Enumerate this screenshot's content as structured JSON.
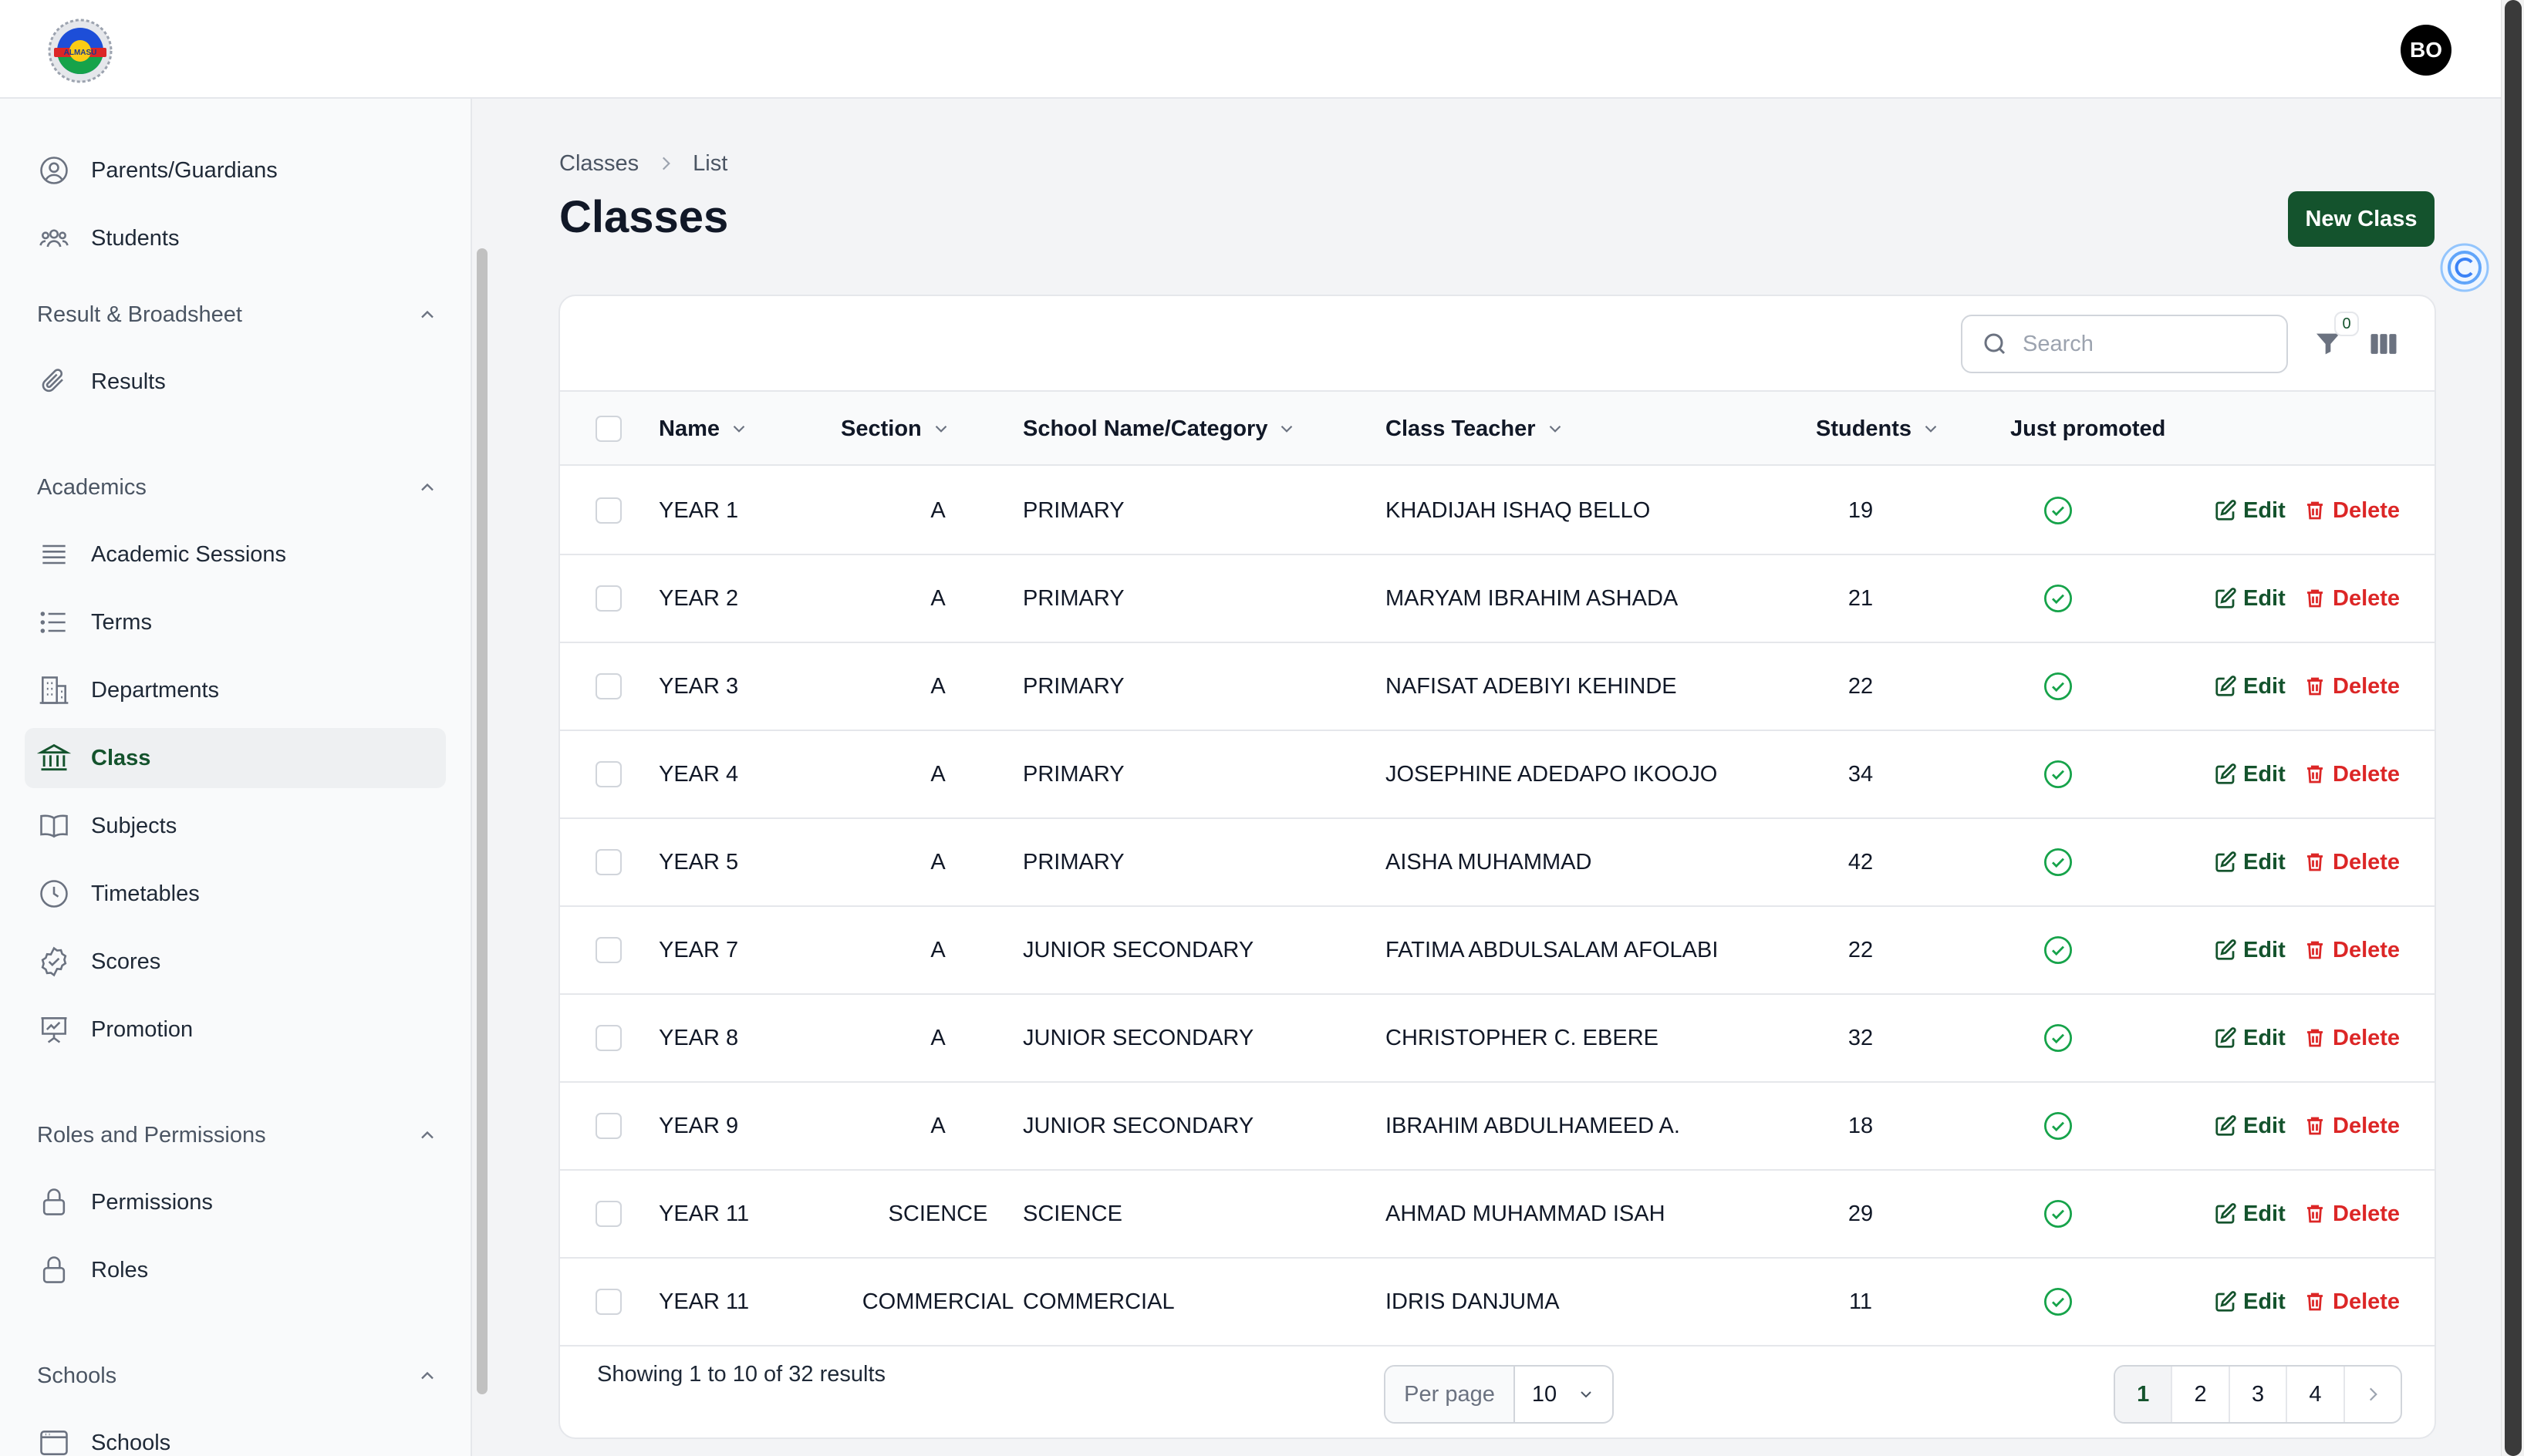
{
  "header": {
    "avatar_initials": "BO",
    "logo_text": "ALMASU"
  },
  "sidebar": {
    "items_top": [
      {
        "label": "Parents/Guardians",
        "icon": "user-circle-icon"
      },
      {
        "label": "Students",
        "icon": "user-group-icon"
      }
    ],
    "groups": [
      {
        "label": "Result & Broadsheet",
        "items": [
          {
            "label": "Results",
            "icon": "paperclip-icon"
          }
        ]
      },
      {
        "label": "Academics",
        "items": [
          {
            "label": "Academic Sessions",
            "icon": "queue-list-icon"
          },
          {
            "label": "Terms",
            "icon": "list-bullet-icon"
          },
          {
            "label": "Departments",
            "icon": "building-office-icon"
          },
          {
            "label": "Class",
            "icon": "building-library-icon",
            "active": true
          },
          {
            "label": "Subjects",
            "icon": "book-open-icon"
          },
          {
            "label": "Timetables",
            "icon": "clock-icon"
          },
          {
            "label": "Scores",
            "icon": "check-badge-icon"
          },
          {
            "label": "Promotion",
            "icon": "presentation-chart-icon"
          }
        ]
      },
      {
        "label": "Roles and Permissions",
        "items": [
          {
            "label": "Permissions",
            "icon": "lock-icon"
          },
          {
            "label": "Roles",
            "icon": "lock-icon"
          }
        ]
      },
      {
        "label": "Schools",
        "items": [
          {
            "label": "Schools",
            "icon": "window-icon"
          }
        ]
      }
    ]
  },
  "main": {
    "breadcrumb": [
      "Classes",
      "List"
    ],
    "title": "Classes",
    "new_button": "New Class",
    "search_placeholder": "Search",
    "filter_count": "0",
    "columns": [
      "Name",
      "Section",
      "School Name/Category",
      "Class Teacher",
      "Students",
      "Just promoted"
    ],
    "rows": [
      {
        "name": "YEAR 1",
        "section": "A",
        "category": "PRIMARY",
        "teacher": "KHADIJAH ISHAQ BELLO",
        "students": "19"
      },
      {
        "name": "YEAR 2",
        "section": "A",
        "category": "PRIMARY",
        "teacher": "MARYAM IBRAHIM ASHADA",
        "students": "21"
      },
      {
        "name": "YEAR 3",
        "section": "A",
        "category": "PRIMARY",
        "teacher": "NAFISAT ADEBIYI KEHINDE",
        "students": "22"
      },
      {
        "name": "YEAR 4",
        "section": "A",
        "category": "PRIMARY",
        "teacher": "JOSEPHINE ADEDAPO IKOOJO",
        "students": "34"
      },
      {
        "name": "YEAR 5",
        "section": "A",
        "category": "PRIMARY",
        "teacher": "AISHA MUHAMMAD",
        "students": "42"
      },
      {
        "name": "YEAR 7",
        "section": "A",
        "category": "JUNIOR SECONDARY",
        "teacher": "FATIMA ABDULSALAM AFOLABI",
        "students": "22"
      },
      {
        "name": "YEAR 8",
        "section": "A",
        "category": "JUNIOR SECONDARY",
        "teacher": "CHRISTOPHER C. EBERE",
        "students": "32"
      },
      {
        "name": "YEAR 9",
        "section": "A",
        "category": "JUNIOR SECONDARY",
        "teacher": "IBRAHIM ABDULHAMEED A.",
        "students": "18"
      },
      {
        "name": "YEAR 11",
        "section": "SCIENCE",
        "category": "SCIENCE",
        "teacher": "AHMAD MUHAMMAD ISAH",
        "students": "29"
      },
      {
        "name": "YEAR 11",
        "section": "COMMERCIAL",
        "category": "COMMERCIAL",
        "teacher": "IDRIS DANJUMA",
        "students": "11"
      }
    ],
    "edit_label": "Edit",
    "delete_label": "Delete",
    "footer": {
      "summary": "Showing 1 to 10 of 32 results",
      "per_page_label": "Per page",
      "per_page_value": "10",
      "pages": [
        "1",
        "2",
        "3",
        "4"
      ],
      "current_page": "1"
    }
  },
  "colors": {
    "brand": "#14532d",
    "danger": "#dc2626",
    "success": "#16a34a"
  }
}
